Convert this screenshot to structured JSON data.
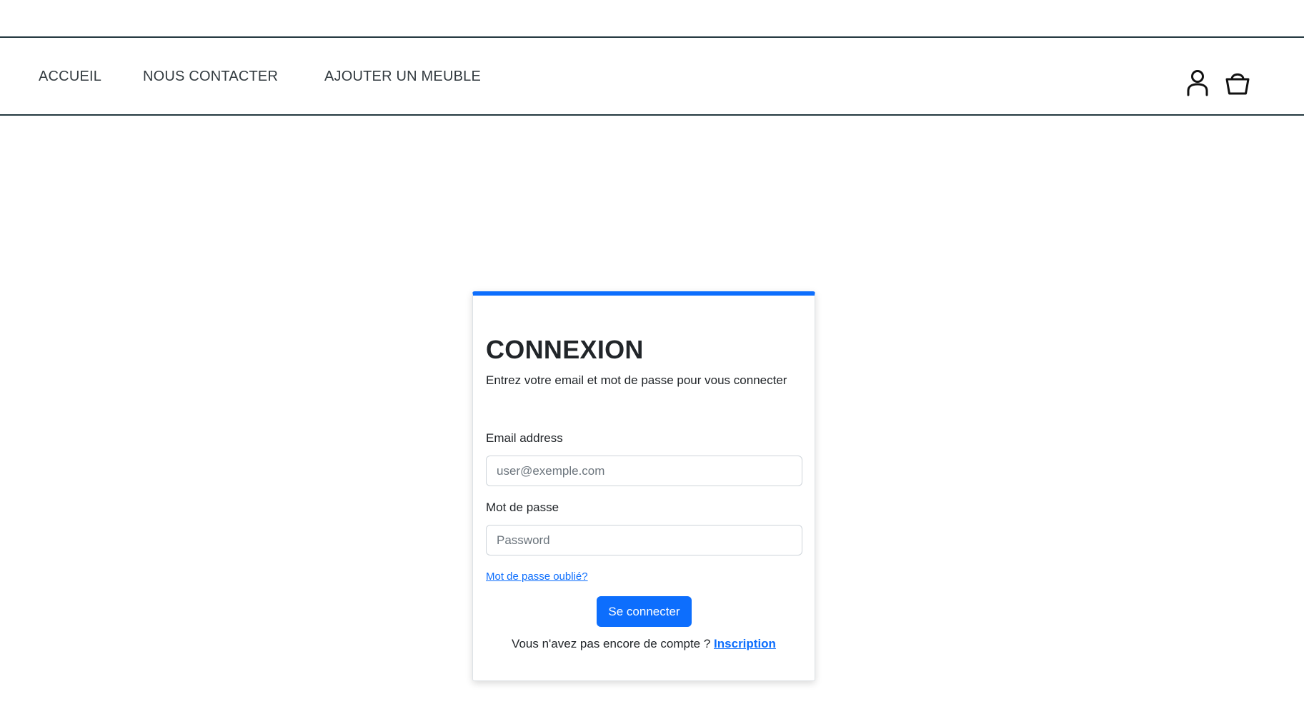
{
  "nav": {
    "items": [
      {
        "label": "ACCUEIL"
      },
      {
        "label": "NOUS CONTACTER"
      },
      {
        "label": "AJOUTER UN MEUBLE"
      }
    ],
    "icons": [
      "user-icon",
      "shopping-bag-icon"
    ]
  },
  "login": {
    "title": "CONNEXION",
    "subtitle": "Entrez votre email et mot de passe pour vous connecter",
    "email_label": "Email address",
    "email_placeholder": "user@exemple.com",
    "email_value": "",
    "password_label": "Mot de passe",
    "password_placeholder": "Password",
    "password_value": "",
    "forgot_link": "Mot de passe oublié?",
    "submit_label": "Se connecter",
    "signup_prompt": "Vous n'avez pas encore de compte ?",
    "signup_link": "Inscription"
  },
  "colors": {
    "primary": "#0d6efd",
    "navbar_border": "#23383f",
    "text": "#212529"
  }
}
